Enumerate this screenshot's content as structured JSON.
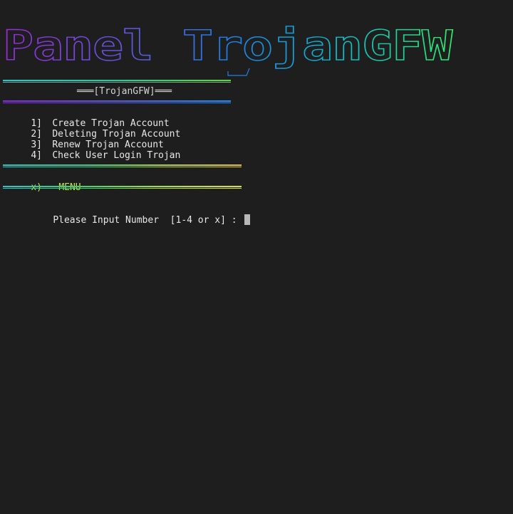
{
  "banner": {
    "text": "Panel TrojanGFW"
  },
  "header": {
    "title": "═══[TrojanGFW]═══"
  },
  "menu": {
    "items": [
      {
        "num": "1]",
        "label": "Create Trojan Account"
      },
      {
        "num": "2]",
        "label": "Deleting Trojan Account"
      },
      {
        "num": "3]",
        "label": "Renew Trojan Account"
      },
      {
        "num": "4]",
        "label": "Check User Login Trojan"
      }
    ]
  },
  "exit": {
    "key": "x)",
    "label": "MENU"
  },
  "prompt": {
    "text": "Please Input Number  [1-4 or x] :"
  },
  "colors": {
    "background": "#1e1e1e",
    "text": "#e8e8e8",
    "accent_exit": "#c8e23c",
    "banner_gradient": [
      "#8a2be2",
      "#6a5acd",
      "#1e90ff",
      "#00bfff",
      "#00e5a0",
      "#2ee86a"
    ]
  }
}
